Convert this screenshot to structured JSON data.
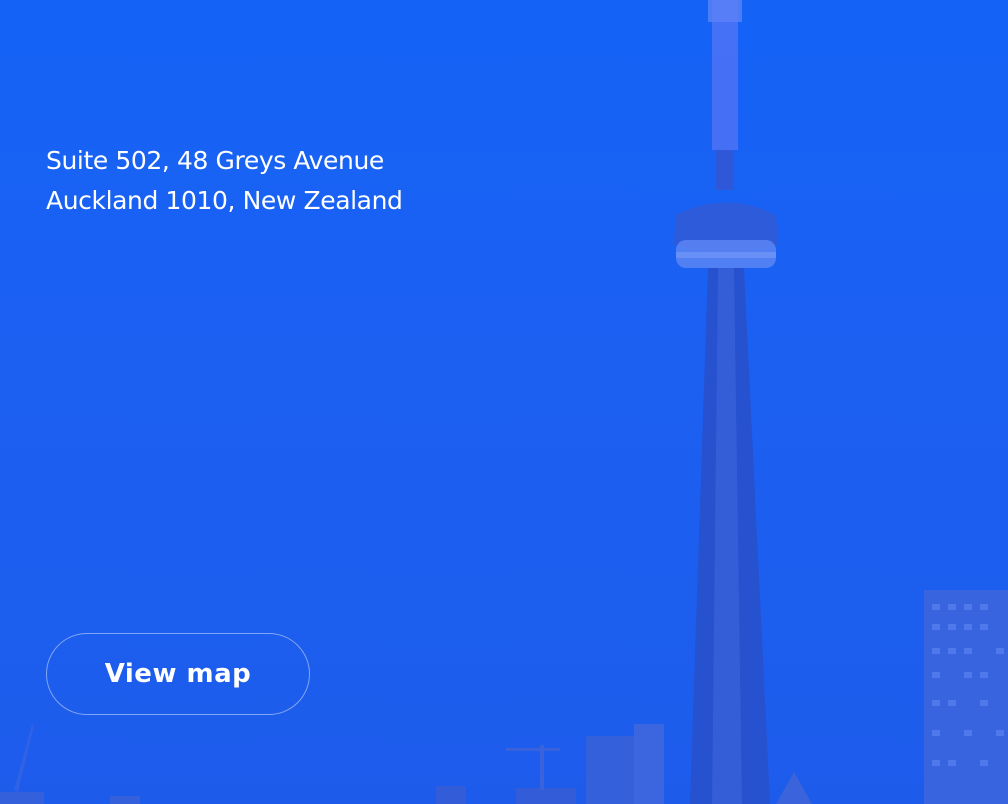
{
  "location": {
    "address_line_1": "Suite 502, 48 Greys Avenue",
    "address_line_2": "Auckland 1010, New Zealand"
  },
  "actions": {
    "view_map_label": "View map"
  },
  "colors": {
    "overlay_blue": "#1a62f3",
    "text": "#ffffff"
  },
  "background": {
    "image": "city-skyline-with-tower"
  }
}
